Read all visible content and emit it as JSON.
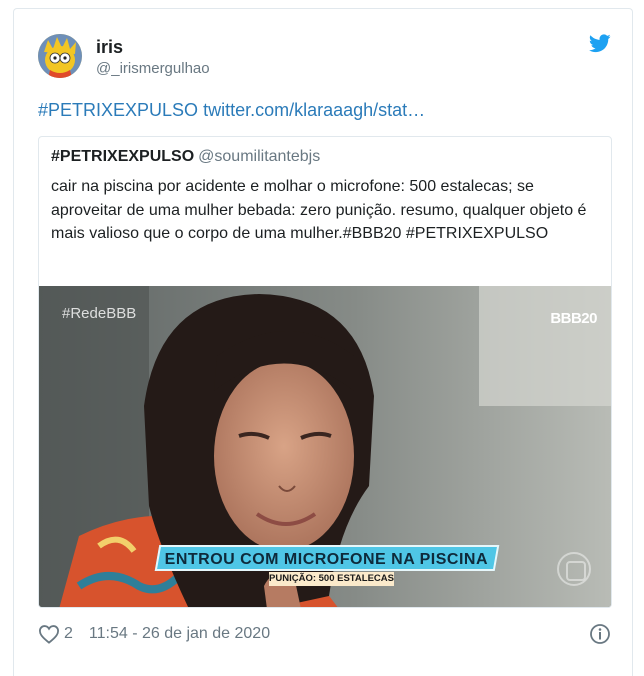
{
  "tweet": {
    "author_name": "iris",
    "author_handle": "@_irismergulhao",
    "hashtag": "#PETRIXEXPULSO",
    "link_text": "twitter.com/klaraaagh/stat…"
  },
  "quoted": {
    "author_name": "#PETRIXEXPULSO",
    "author_handle": "@soumilitantebjs",
    "body": "cair na piscina por acidente e molhar o microfone: 500 estalecas; se aproveitar de uma mulher bebada: zero punição. resumo, qualquer objeto é mais valioso que o corpo de uma mulher.#BBB20 #PETRIXEXPULSO",
    "media": {
      "watermark_left": "#RedeBBB",
      "watermark_right": "BBB20",
      "caption_main": "ENTROU COM MICROFONE NA PISCINA",
      "caption_sub": "PUNIÇÃO: 500 ESTALECAS"
    }
  },
  "footer": {
    "likes": "2",
    "timestamp": "11:54 - 26 de jan de 2020"
  },
  "icons": {
    "bird": "twitter-bird-icon",
    "heart": "heart-icon",
    "info": "info-icon"
  },
  "colors": {
    "link": "#2b7bb9",
    "twitter_blue": "#1da1f2",
    "muted": "#697882",
    "border": "#e1e8ed"
  }
}
